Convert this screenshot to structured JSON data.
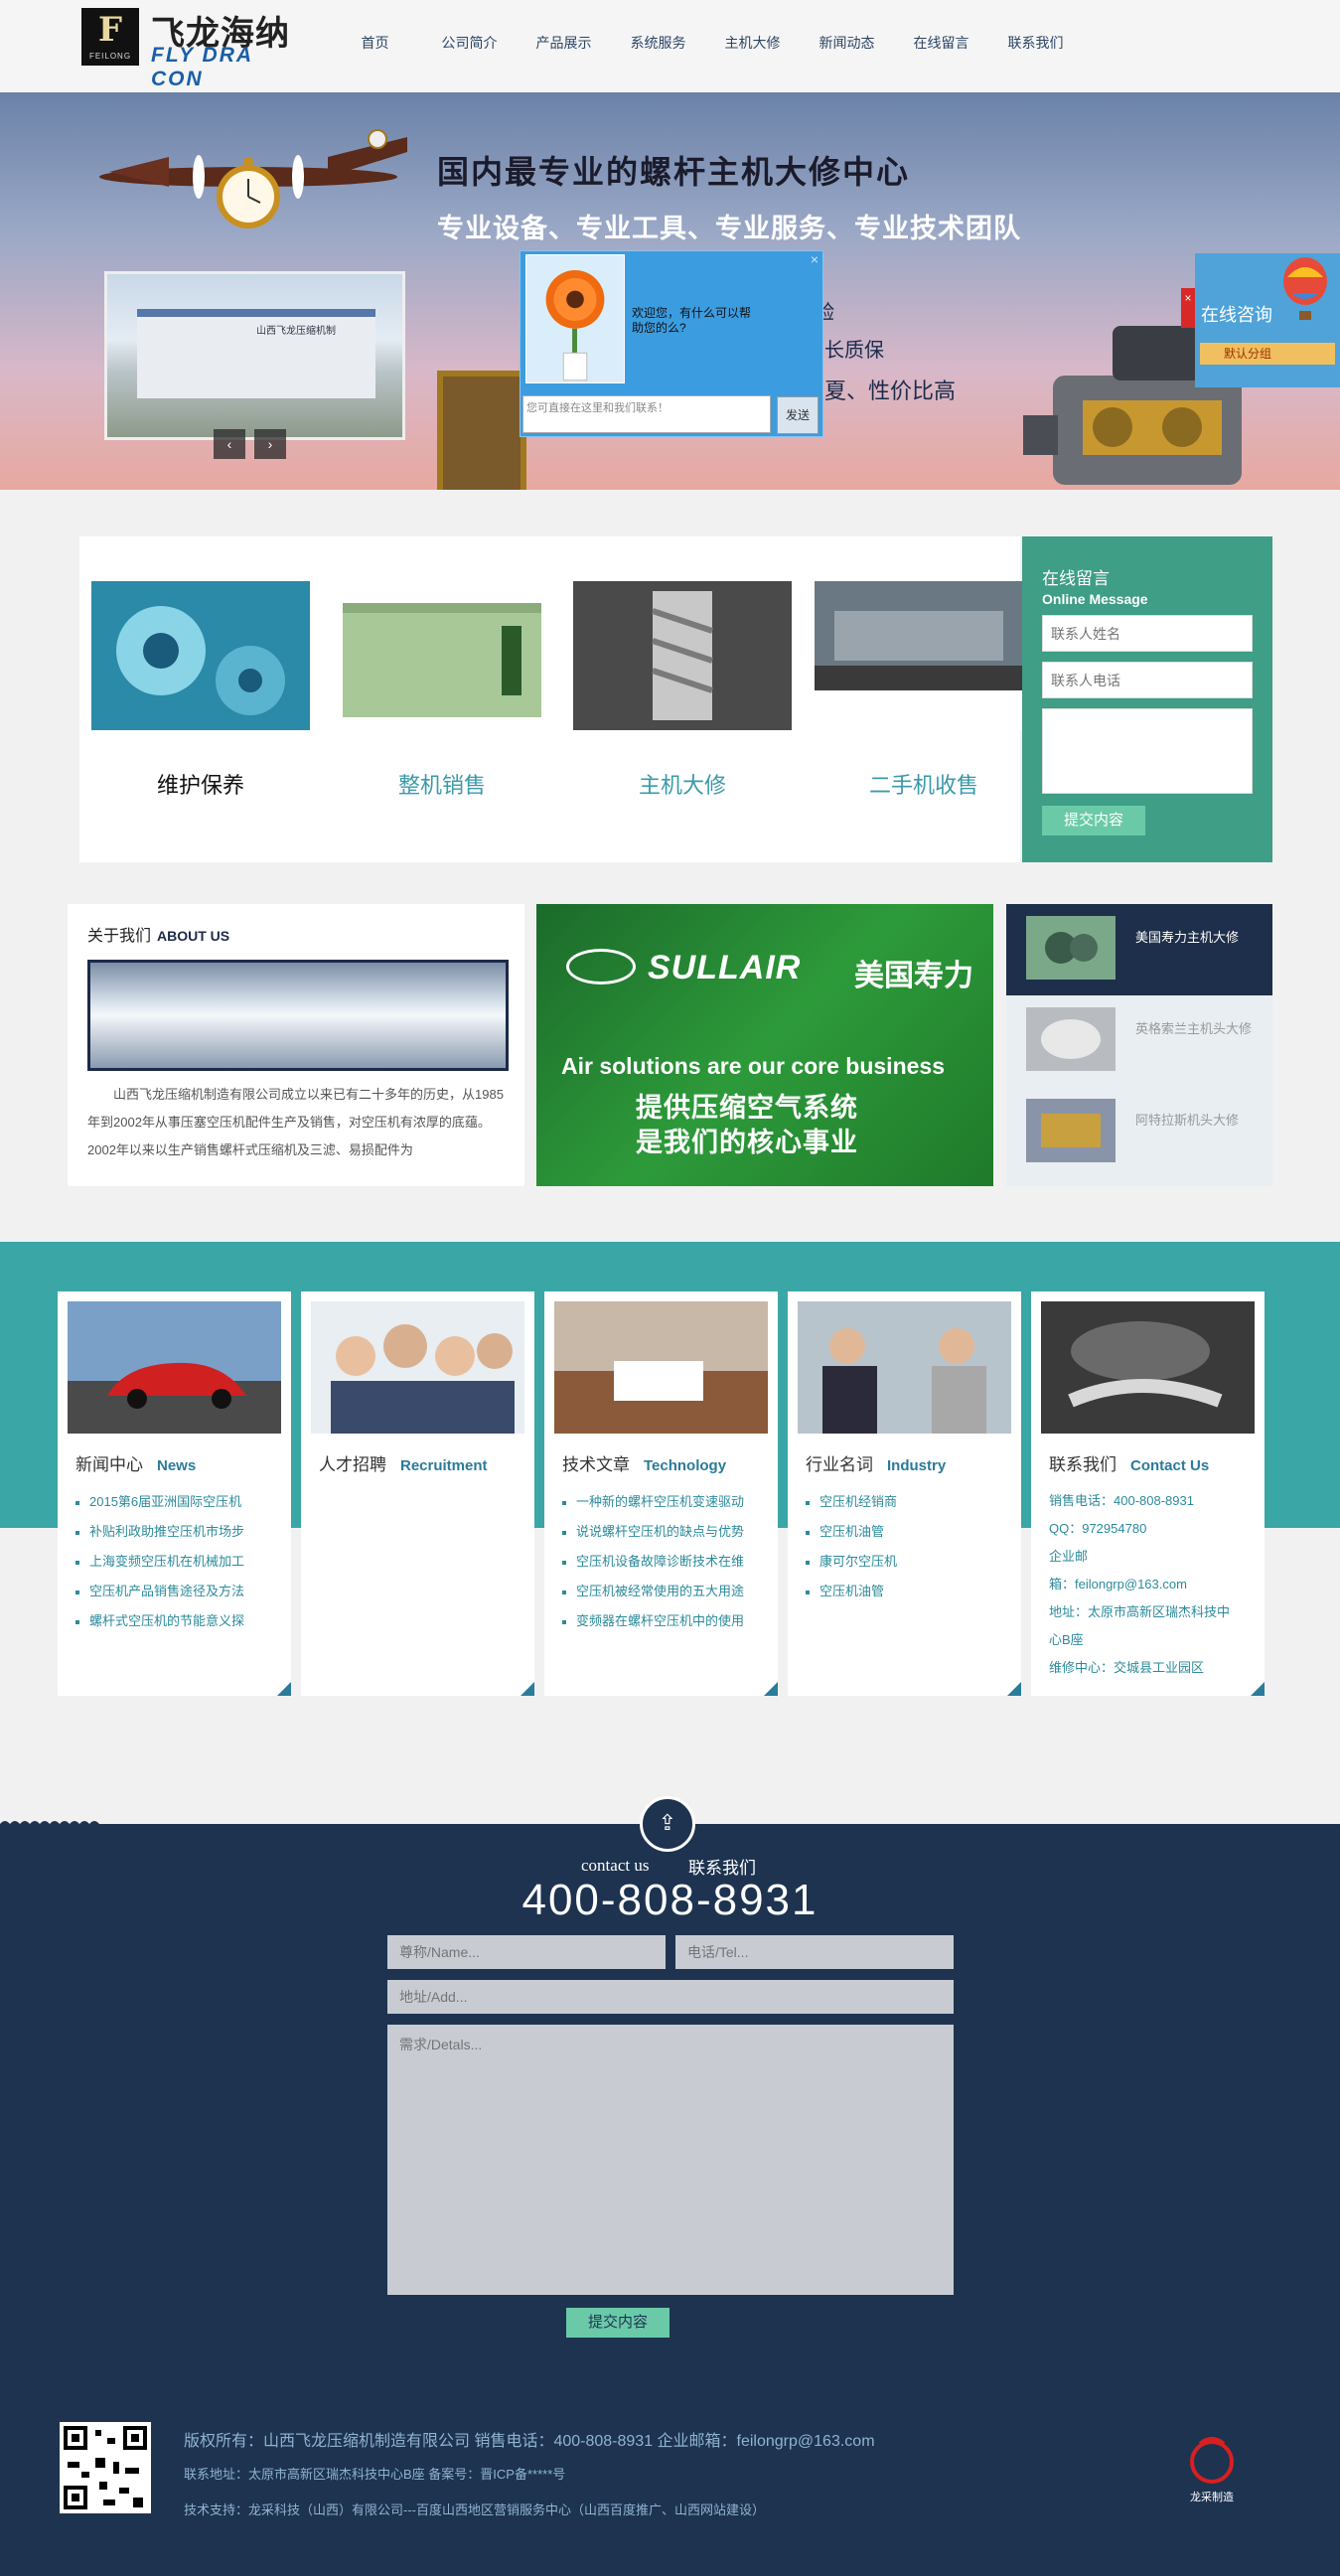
{
  "brand": {
    "logo_letter": "F",
    "logo_sub": "FEILONG",
    "name_cn": "飞龙海纳",
    "name_en": "FLY DRA CON"
  },
  "nav": [
    "首页",
    "公司简介",
    "产品展示",
    "系统服务",
    "主机大修",
    "新闻动态",
    "在线留言",
    "联系我们"
  ],
  "banner": {
    "headline": "国内最专业的螺杆主机大修中心",
    "subline": "专业设备、专业工具、专业服务、专业技术团队",
    "line1": "验",
    "line2": "长质保",
    "line3": "夏、性价比高",
    "factory_sign": "山西飞龙压缩机制",
    "prev": "‹",
    "next": "›"
  },
  "chat": {
    "greeting": "欢迎您，有什么可以帮助您的么?",
    "placeholder": "您可直接在这里和我们联系！",
    "send": "发送",
    "close": "×"
  },
  "consult": {
    "title": "在线咨询",
    "group": "默认分组",
    "close": "×"
  },
  "services": [
    {
      "label": "维护保养",
      "color": "#111111"
    },
    {
      "label": "整机销售",
      "color": "#3a9aa8"
    },
    {
      "label": "主机大修",
      "color": "#3a9aa8"
    },
    {
      "label": "二手机收售",
      "color": "#3a9aa8"
    }
  ],
  "message": {
    "title_cn": "在线留言",
    "title_en": "Online Message",
    "name_placeholder": "联系人姓名",
    "phone_placeholder": "联系人电话",
    "submit": "提交内容"
  },
  "about": {
    "title_cn": "关于我们",
    "title_en": "ABOUT US",
    "text": "山西飞龙压缩机制造有限公司成立以来已有二十多年的历史，从1985年到2002年从事压塞空压机配件生产及销售，对空压机有浓厚的底蕴。2002年以来以生产销售螺杆式压缩机及三滤、易损配件为"
  },
  "sullair": {
    "brand": "SULLAIR",
    "brand_cn": "美国寿力",
    "line_en": "Air solutions are our core business",
    "line_cn1": "提供压缩空气系统",
    "line_cn2": "是我们的核心事业"
  },
  "repairs": [
    {
      "label": "美国寿力主机大修",
      "active": true
    },
    {
      "label": "英格索兰主机头大修",
      "active": false
    },
    {
      "label": "阿特拉斯机头大修",
      "active": false
    }
  ],
  "cards": [
    {
      "title_cn": "新闻中心",
      "title_en": "News",
      "items": [
        "2015第6届亚洲国际空压机",
        "补贴利政助推空压机市场步",
        "上海变频空压机在机械加工",
        "空压机产品销售途径及方法",
        "螺杆式空压机的节能意义探"
      ]
    },
    {
      "title_cn": "人才招聘",
      "title_en": "Recruitment",
      "items": []
    },
    {
      "title_cn": "技术文章",
      "title_en": "Technology",
      "items": [
        "一种新的螺杆空压机变速驱动",
        "说说螺杆空压机的缺点与优势",
        "空压机设备故障诊断技术在维",
        "空压机被经常使用的五大用途",
        "变频器在螺杆空压机中的使用"
      ]
    },
    {
      "title_cn": "行业名词",
      "title_en": "Industry",
      "items": [
        "空压机经销商",
        "空压机油管",
        "康可尔空压机",
        "空压机油管"
      ]
    },
    {
      "title_cn": "联系我们",
      "title_en": "Contact Us",
      "lines": [
        "销售电话：400-808-8931",
        "QQ：972954780",
        "企业邮",
        "箱：feilongrp@163.com",
        "地址：太原市高新区瑞杰科技中",
        "心B座",
        "维修中心：交城县工业园区"
      ]
    }
  ],
  "footer": {
    "up_icon": "⇪",
    "contact_en": "contact us",
    "contact_cn": "联系我们",
    "phone": "400-808-8931",
    "name_placeholder": "尊称/Name...",
    "tel_placeholder": "电话/Tel...",
    "addr_placeholder": "地址/Add...",
    "details_placeholder": "需求/Detals...",
    "submit": "提交内容",
    "copyright": "版权所有：山西飞龙压缩机制造有限公司  销售电话：400-808-8931 企业邮箱：feilongrp@163.com",
    "address": "联系地址：太原市高新区瑞杰科技中心B座 备案号：晋ICP备*****号",
    "support": "技术支持：龙采科技（山西）有限公司---百度山西地区营销服务中心（山西百度推广、山西网站建设）",
    "maker": "龙采制造"
  },
  "colors": {
    "navy": "#1d3350",
    "teal": "#3aa6a6",
    "green": "#3e9e86",
    "button": "#6acaa8"
  }
}
